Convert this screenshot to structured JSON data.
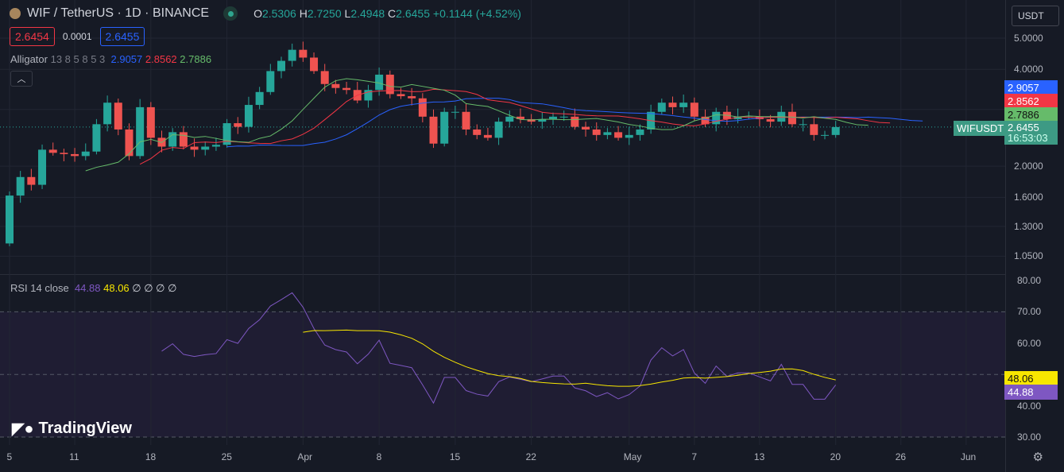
{
  "header": {
    "symbol": "WIF / TetherUS · 1D · BINANCE",
    "o_label": "O",
    "o": "2.5306",
    "h_label": "H",
    "h": "2.7250",
    "l_label": "L",
    "l": "2.4948",
    "c_label": "C",
    "c": "2.6455",
    "change": "+0.1144 (+4.52%)",
    "bid": "2.6454",
    "spread": "0.0001",
    "ask": "2.6455",
    "currency": "USDT"
  },
  "alligator": {
    "label": "Alligator",
    "params": "13 8 5 8 5 3",
    "jaw": "2.9057",
    "teeth": "2.8562",
    "lips": "2.7886"
  },
  "price_labels": {
    "jaw": "2.9057",
    "teeth": "2.8562",
    "lips": "2.7886",
    "last": "2.6455",
    "countdown": "16:53:03",
    "symbol_tag": "WIFUSDT"
  },
  "rsi": {
    "label": "RSI",
    "params": "14 close",
    "value": "44.88",
    "ma": "48.06",
    "extras": "∅ ∅ ∅ ∅"
  },
  "colors": {
    "up": "#26a69a",
    "down": "#ef5350",
    "jaw": "#2962ff",
    "teeth": "#f23645",
    "lips": "#66bb6a",
    "rsi": "#7e57c2",
    "rsi_ma": "#f7e600"
  },
  "branding": "TradingView",
  "chart_data": {
    "type": "candlestick",
    "title": "WIF / TetherUS · 1D · BINANCE",
    "scale": "log",
    "ylim": [
      0.95,
      5.3
    ],
    "price_ticks": [
      "5.0000",
      "4.0000",
      "2.0000",
      "1.6000",
      "1.3000",
      "1.0500"
    ],
    "rsi_ticks": [
      "80.00",
      "70.00",
      "60.00",
      "40.00",
      "30.00"
    ],
    "x_ticks": [
      {
        "day": 0,
        "label": "5"
      },
      {
        "day": 6,
        "label": "11"
      },
      {
        "day": 13,
        "label": "18"
      },
      {
        "day": 20,
        "label": "25"
      },
      {
        "day": 27,
        "label": "Apr"
      },
      {
        "day": 34,
        "label": "8"
      },
      {
        "day": 41,
        "label": "15"
      },
      {
        "day": 48,
        "label": "22"
      },
      {
        "day": 57,
        "label": "May"
      },
      {
        "day": 63,
        "label": "7"
      },
      {
        "day": 69,
        "label": "13"
      },
      {
        "day": 76,
        "label": "20"
      },
      {
        "day": 82,
        "label": "26"
      },
      {
        "day": 88,
        "label": "Jun"
      }
    ],
    "start_date": "Mar 5",
    "first_open": 1.15,
    "closes": [
      1.62,
      1.85,
      1.75,
      2.25,
      2.2,
      2.18,
      2.15,
      2.22,
      2.7,
      3.15,
      2.6,
      2.15,
      3.05,
      2.45,
      2.3,
      2.55,
      2.3,
      2.25,
      2.3,
      2.33,
      2.72,
      2.65,
      3.1,
      3.4,
      3.95,
      4.25,
      4.6,
      4.35,
      3.95,
      3.6,
      3.5,
      3.45,
      3.2,
      3.45,
      3.85,
      3.35,
      3.3,
      3.25,
      2.85,
      2.35,
      2.95,
      2.95,
      2.6,
      2.5,
      2.45,
      2.75,
      2.85,
      2.8,
      2.75,
      2.8,
      2.85,
      2.85,
      2.65,
      2.6,
      2.5,
      2.55,
      2.45,
      2.5,
      2.6,
      2.95,
      3.15,
      3.05,
      3.15,
      2.85,
      2.7,
      2.95,
      2.8,
      2.85,
      2.85,
      2.8,
      2.75,
      2.95,
      2.7,
      2.7,
      2.5,
      2.5,
      2.6455
    ]
  }
}
